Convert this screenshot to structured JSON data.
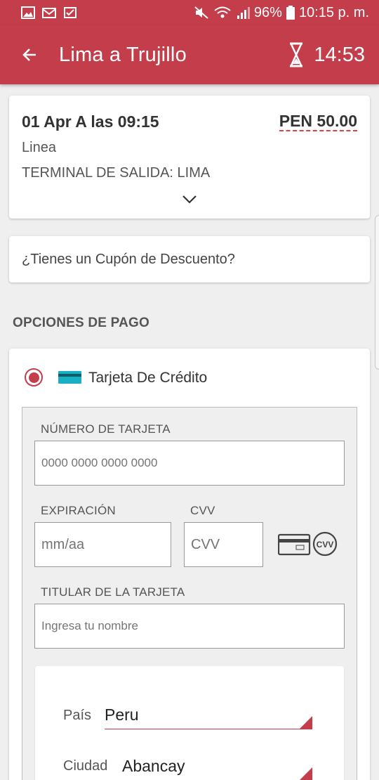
{
  "status_bar": {
    "battery": "96%",
    "time": "10:15 p. m."
  },
  "app_bar": {
    "title": "Lima a Trujillo",
    "timer": "14:53"
  },
  "trip": {
    "date_time": "01 Apr A las 09:15",
    "price": "PEN 50.00",
    "line": "Linea",
    "terminal": "TERMINAL DE SALIDA: LIMA"
  },
  "coupon": {
    "label": "¿Tienes un Cupón de Descuento?"
  },
  "payment": {
    "section_title": "OPCIONES DE PAGO",
    "method_label": "Tarjeta De Crédito",
    "card_number_label": "NÚMERO DE TARJETA",
    "card_number_placeholder": "0000 0000 0000 0000",
    "expiry_label": "EXPIRACIÓN",
    "expiry_placeholder": "mm/aa",
    "cvv_label": "CVV",
    "cvv_placeholder": "CVV",
    "cvv_icon_text": "CVV",
    "holder_label": "TITULAR DE LA TARJETA",
    "holder_placeholder": "Ingresa tu nombre",
    "country_label": "País",
    "country_value": "Peru",
    "city_label": "Ciudad",
    "city_value": "Abancay"
  },
  "colors": {
    "brand": "#c43d4b",
    "card_icon": "#1ab0c4"
  }
}
